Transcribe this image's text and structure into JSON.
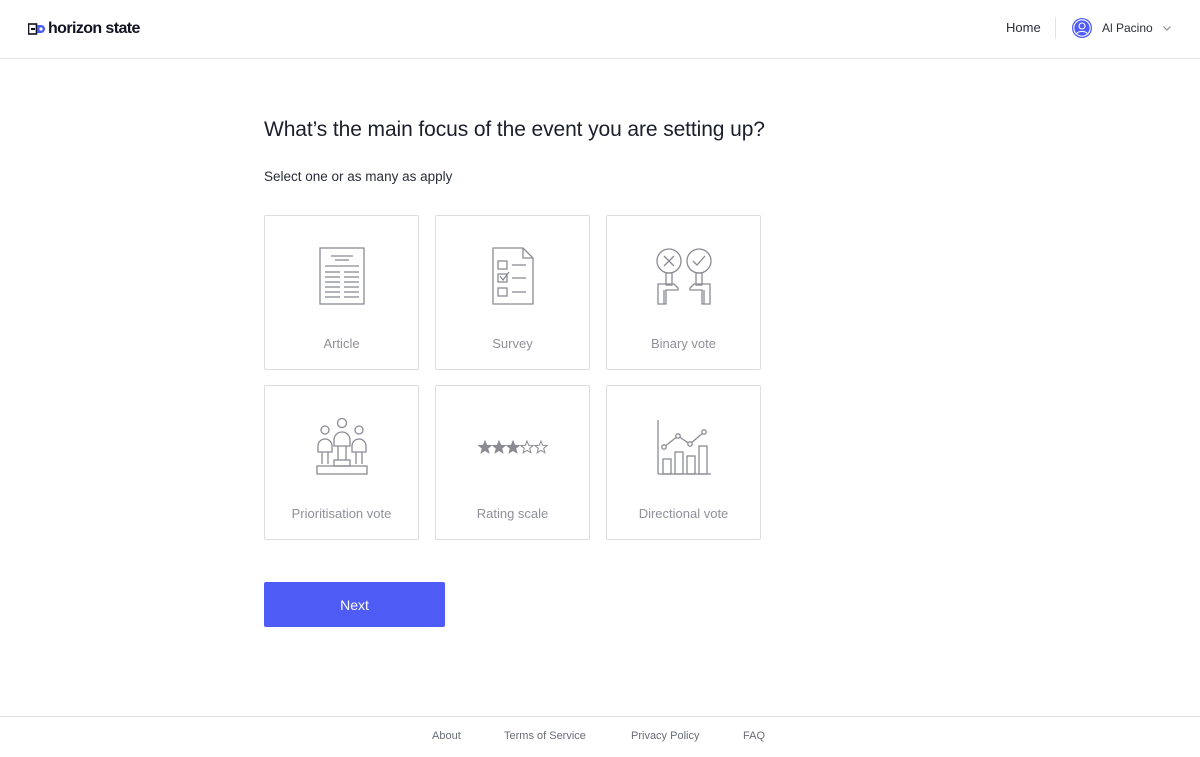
{
  "header": {
    "logo_text": "horizon state",
    "nav_home": "Home",
    "user_name": "Al Pacino"
  },
  "main": {
    "title": "What’s the main focus of the event you are setting up?",
    "subtitle": "Select one or as many as apply",
    "options": [
      {
        "label": "Article",
        "icon": "article-icon"
      },
      {
        "label": "Survey",
        "icon": "survey-icon"
      },
      {
        "label": "Binary vote",
        "icon": "binary-vote-icon"
      },
      {
        "label": "Prioritisation vote",
        "icon": "podium-icon"
      },
      {
        "label": "Rating scale",
        "icon": "star-rating-icon",
        "rating": {
          "filled": 3,
          "total": 5
        }
      },
      {
        "label": "Directional vote",
        "icon": "line-bar-chart-icon"
      }
    ],
    "next_label": "Next"
  },
  "footer": {
    "links": [
      "About",
      "Terms of Service",
      "Privacy Policy",
      "FAQ"
    ]
  },
  "colors": {
    "accent": "#4e5cf5",
    "icon_stroke": "#8a8b93",
    "border": "#dcdde1",
    "label": "#8f9099"
  }
}
